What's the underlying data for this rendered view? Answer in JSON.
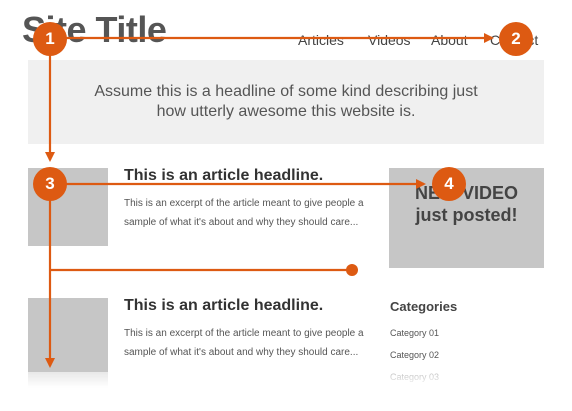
{
  "site": {
    "title": "Site Title"
  },
  "nav": {
    "items": [
      "Articles",
      "Videos",
      "About",
      "Contact"
    ]
  },
  "hero": {
    "headline": "Assume this is a headline of some kind describing just how utterly awesome this website is."
  },
  "articles": [
    {
      "headline": "This is an article headline.",
      "excerpt": "This is an excerpt of the article meant to give people a sample of what it's about and why they should care..."
    },
    {
      "headline": "This is an article headline.",
      "excerpt": "This is an excerpt of the article meant to give people a sample of what it's about and why they should care..."
    }
  ],
  "video_promo": {
    "text": "NEW VIDEO just posted!"
  },
  "categories": {
    "title": "Categories",
    "items": [
      "Category 01",
      "Category 02",
      "Category 03"
    ]
  },
  "annotations": {
    "markers": [
      "1",
      "2",
      "3",
      "4"
    ],
    "accent_color": "#dd5a12"
  }
}
